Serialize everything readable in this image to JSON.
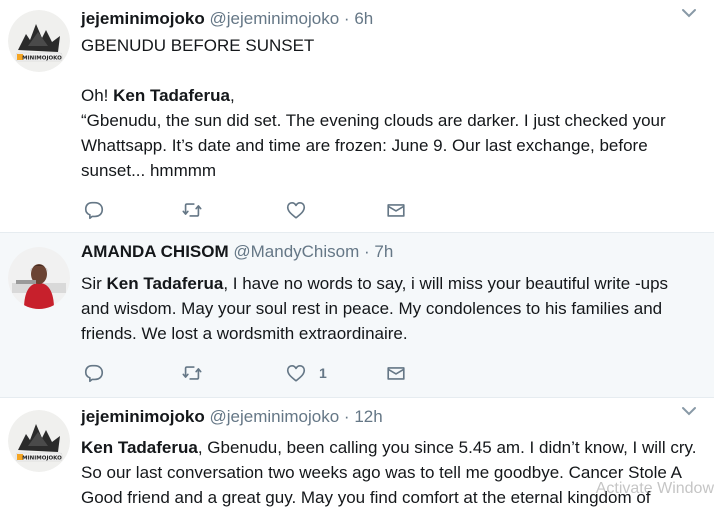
{
  "tweets": [
    {
      "name": "jejeminimojoko",
      "handle": "@jejeminimojoko",
      "dot": "·",
      "time": "6h",
      "lines": [
        "GBENUDU BEFORE SUNSET",
        "",
        "Oh! ",
        "Ken Tadaferua",
        ",",
        "“Gbenudu, the sun did set. The evening clouds are darker. I just checked your",
        "Whattsapp. It’s date and time are frozen: June 9. Our last exchange, before",
        "sunset... hmmmm"
      ],
      "avatar_text": "MINIMOJOKO",
      "like_count": ""
    },
    {
      "name": "AMANDA CHISOM",
      "handle": "@MandyChisom",
      "dot": "·",
      "time": "7h",
      "lines": [
        "Sir ",
        "Ken Tadaferua",
        ", I have no words to say, i will miss your beautiful write -ups",
        "and wisdom. May your soul rest in peace. My condolences to his families and",
        "friends. We lost a wordsmith extraordinaire."
      ],
      "like_count": "1"
    },
    {
      "name": "jejeminimojoko",
      "handle": "@jejeminimojoko",
      "dot": "·",
      "time": "12h",
      "lines": [
        "Ken Tadaferua",
        ", Gbenudu, been calling you since 5.45 am. I didn’t know, I will cry.",
        "So our last conversation two weeks ago was to tell me goodbye. Cancer Stole A",
        "Good friend and a great guy. May you find comfort at the eternal kingdom of"
      ],
      "avatar_text": "MINIMOJOKO"
    }
  ],
  "icons": {
    "more": "chevron-down-icon",
    "reply": "reply-icon",
    "retweet": "retweet-icon",
    "like": "heart-icon",
    "dm": "envelope-icon"
  },
  "colors": {
    "text": "#14171a",
    "secondary": "#657786",
    "icon": "#657786",
    "divider": "#e6ecf0",
    "highlight_bg": "#f5f8fa"
  },
  "watermark": "Activate Window"
}
